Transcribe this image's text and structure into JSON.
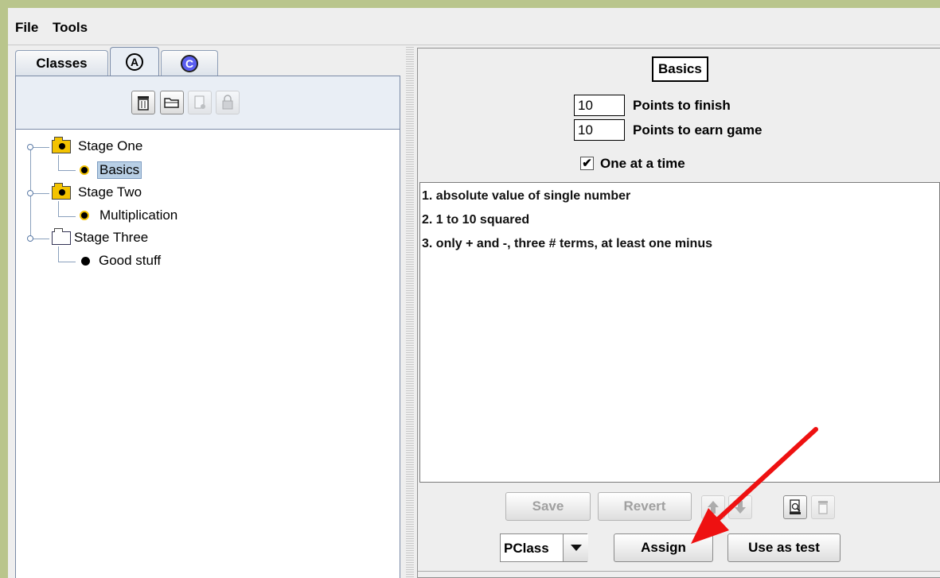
{
  "menu": {
    "file": "File",
    "tools": "Tools"
  },
  "tabs": {
    "classes": "Classes",
    "a": "A",
    "c": "C"
  },
  "tree": [
    {
      "label": "Stage One",
      "children": [
        "Basics"
      ]
    },
    {
      "label": "Stage Two",
      "children": [
        "Multiplication"
      ]
    },
    {
      "label": "Stage Three",
      "children": [
        "Good stuff"
      ]
    }
  ],
  "tree_labels": {
    "stage1": "Stage One",
    "basics": "Basics",
    "stage2": "Stage Two",
    "multiplication": "Multiplication",
    "stage3": "Stage Three",
    "good": "Good stuff"
  },
  "selected_item": "Basics",
  "detail": {
    "title": "Basics",
    "points_finish_value": "10",
    "points_finish_label": "Points to finish",
    "points_game_value": "10",
    "points_game_label": "Points to earn game",
    "one_at_a_time_label": "One at a time",
    "one_at_a_time_checked": true,
    "check_glyph": "✔"
  },
  "items": [
    "1. absolute value of single number",
    "2. 1 to 10 squared",
    "3. only + and -, three # terms, at least one minus"
  ],
  "buttons": {
    "save": "Save",
    "revert": "Revert",
    "assign": "Assign",
    "use_as_test": "Use as test"
  },
  "combo": {
    "value": "PClass"
  },
  "icons": [
    "trash-icon",
    "open-folder-icon",
    "new-file-icon",
    "lock-icon",
    "arrow-up-icon",
    "arrow-down-icon",
    "print-preview-icon",
    "trash-icon"
  ],
  "colors": {
    "accent_arrow": "#ee1111",
    "selection": "#b8cfe5",
    "window_border": "#b9c58c"
  }
}
